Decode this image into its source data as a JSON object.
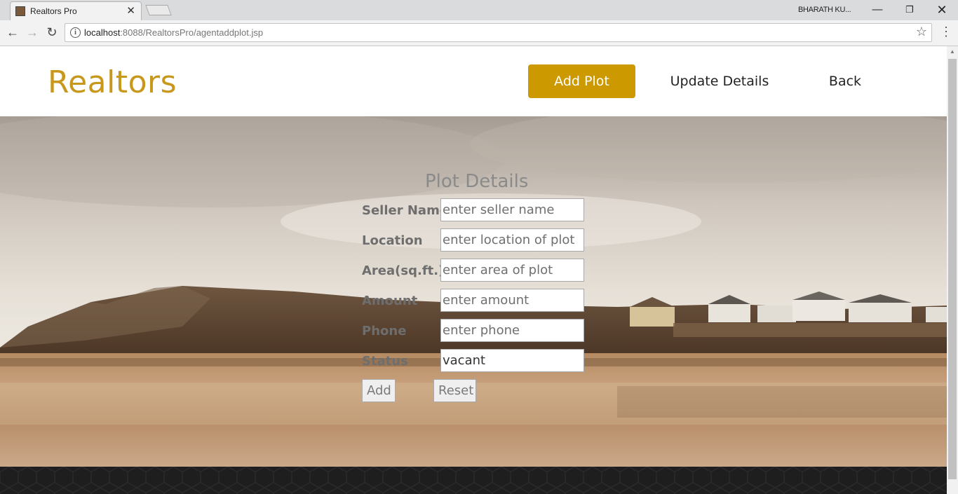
{
  "browser": {
    "tab_title": "Realtors Pro",
    "tab_close": "✕",
    "window_user": "BHARATH KU...",
    "url_host": "localhost",
    "url_path": ":8088/RealtorsPro/agentaddplot.jsp"
  },
  "header": {
    "logo": "Realtors",
    "nav": [
      {
        "label": "Add Plot"
      },
      {
        "label": "Update Details"
      },
      {
        "label": "Back"
      }
    ]
  },
  "form": {
    "title": "Plot Details",
    "fields": [
      {
        "label": "Seller Name",
        "placeholder": "enter seller name",
        "value": ""
      },
      {
        "label": "Location",
        "placeholder": "enter location of plot",
        "value": ""
      },
      {
        "label": "Area(sq.ft.)",
        "placeholder": "enter area of plot",
        "value": ""
      },
      {
        "label": "Amount",
        "placeholder": "enter amount",
        "value": ""
      },
      {
        "label": "Phone",
        "placeholder": "enter phone",
        "value": ""
      },
      {
        "label": "Status",
        "placeholder": "",
        "value": "vacant"
      }
    ],
    "add_label": "Add",
    "reset_label": "Reset"
  },
  "colors": {
    "brand": "#c8981c",
    "nav_active": "#cc9900",
    "footer": "#1e1e1e"
  },
  "icons": {
    "tab_favicon": "realtors-favicon",
    "info": "info-icon",
    "star": "star-icon"
  }
}
